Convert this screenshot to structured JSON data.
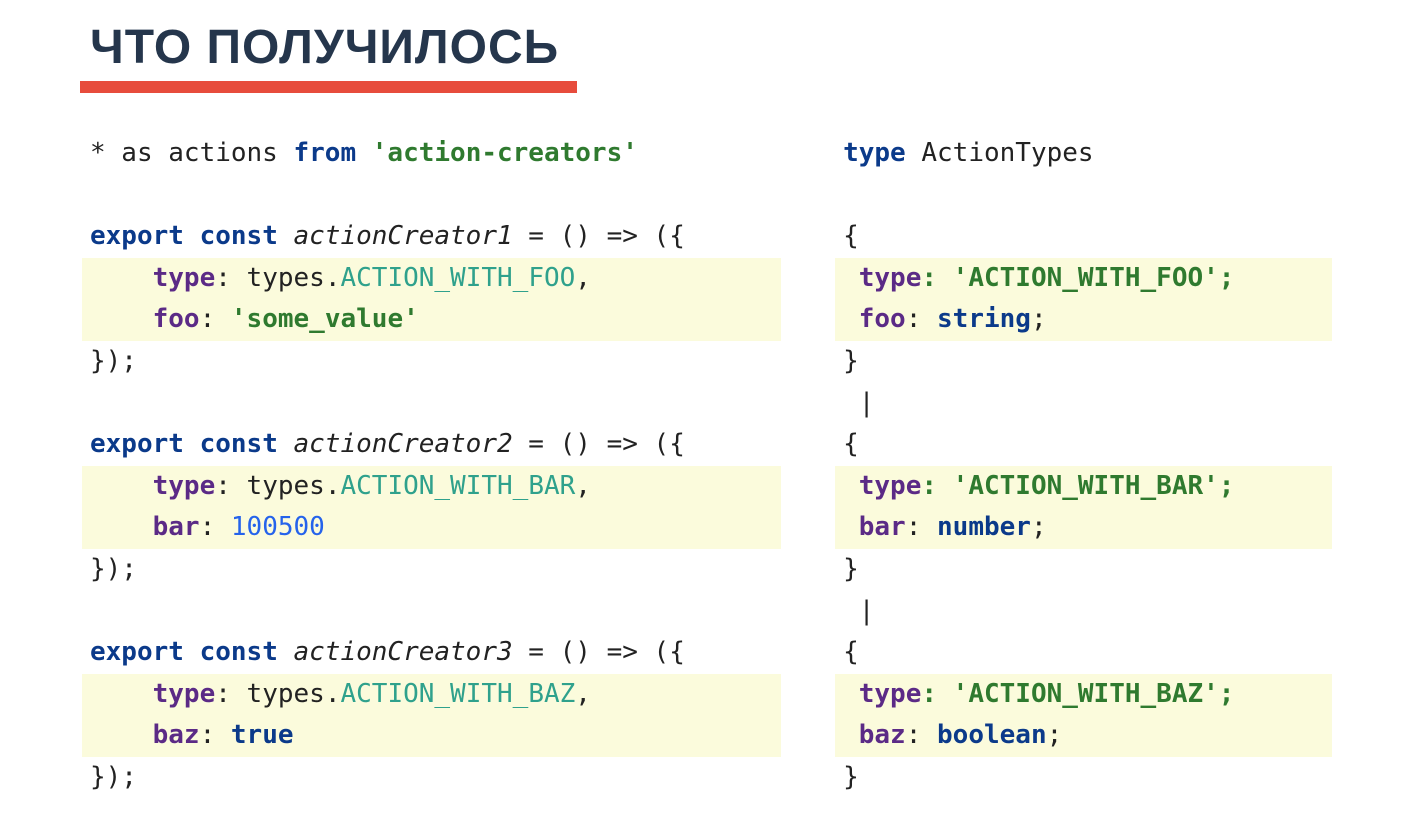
{
  "title": "ЧТО ПОЛУЧИЛОСЬ",
  "left": {
    "import_line": {
      "star_as_actions": "* as actions ",
      "from_kw": "from",
      "module": " 'action-creators'"
    },
    "fn1": {
      "export_kw": "export",
      "const_kw": " const",
      "name": " actionCreator1",
      "arrow": " = () => ({",
      "type_prop": "type",
      "types_prefix": ": types.",
      "type_val": "ACTION_WITH_FOO",
      "comma": ",",
      "payload_prop": "foo",
      "payload_colon": ": ",
      "payload_val": "'some_value'",
      "close": "});"
    },
    "fn2": {
      "export_kw": "export",
      "const_kw": " const",
      "name": " actionCreator2",
      "arrow": " = () => ({",
      "type_prop": "type",
      "types_prefix": ": types.",
      "type_val": "ACTION_WITH_BAR",
      "comma": ",",
      "payload_prop": "bar",
      "payload_colon": ": ",
      "payload_val": "100500",
      "close": "});"
    },
    "fn3": {
      "export_kw": "export",
      "const_kw": " const",
      "name": " actionCreator3",
      "arrow": " = () => ({",
      "type_prop": "type",
      "types_prefix": ": types.",
      "type_val": "ACTION_WITH_BAZ",
      "comma": ",",
      "payload_prop": "baz",
      "payload_colon": ": ",
      "payload_val": "true",
      "close": "});"
    }
  },
  "right": {
    "header": {
      "type_kw": "type",
      "name": " ActionTypes"
    },
    "open1": "{",
    "t1_type_prop": "type",
    "t1_type_val": ": 'ACTION_WITH_FOO';",
    "t1_payload_prop": "foo",
    "t1_payload_sep": ": ",
    "t1_payload_type": "string",
    "t1_payload_end": ";",
    "close1": "}",
    "pipe1": " |",
    "open2": "{",
    "t2_type_prop": "type",
    "t2_type_val": ": 'ACTION_WITH_BAR';",
    "t2_payload_prop": "bar",
    "t2_payload_sep": ": ",
    "t2_payload_type": "number",
    "t2_payload_end": ";",
    "close2": "}",
    "pipe2": " |",
    "open3": "{",
    "t3_type_prop": "type",
    "t3_type_val": ": 'ACTION_WITH_BAZ';",
    "t3_payload_prop": "baz",
    "t3_payload_sep": ": ",
    "t3_payload_type": "boolean",
    "t3_payload_end": ";",
    "close3": "}"
  }
}
